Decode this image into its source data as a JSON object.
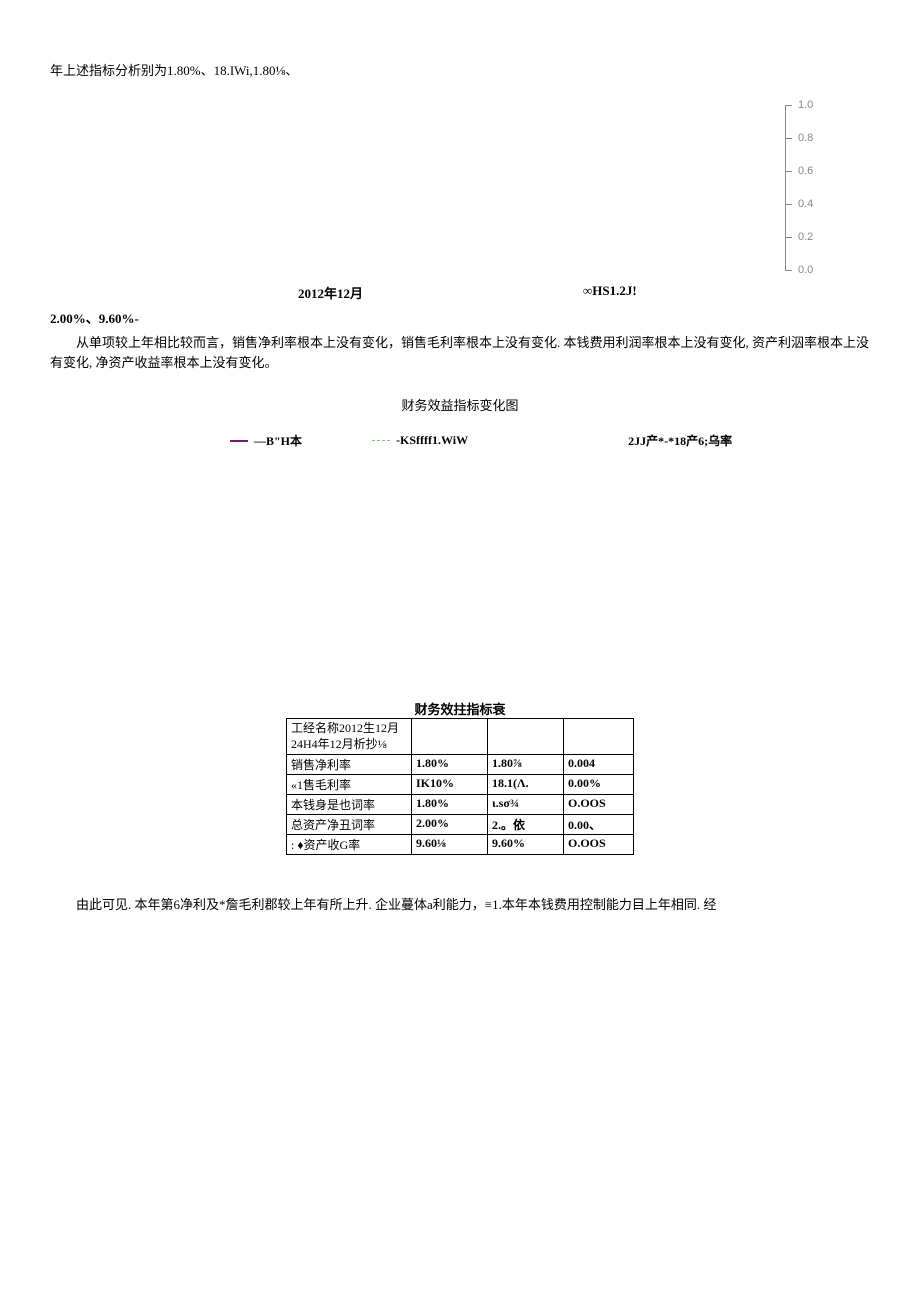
{
  "line1": "年上述指标分析别为1.80%、18.IWi,1.80⅛、",
  "axis_ticks": [
    "1.0",
    "0.8",
    "0.6",
    "0.4",
    "0.2",
    "0.0"
  ],
  "mid_text1": "2012年12月",
  "mid_text2": "∞HS1.2J!",
  "line2": "2.00%、9.60%-",
  "para1": "从单项较上年相比较而言，销售净利率根本上没有变化，销售毛利率根本上没有变化. 本钱费用利润率根本上没有变化, 资产利泅率根本上没有变化, 净资产收益率根本上没有变化。",
  "chart_title": "财务效益指标变化图",
  "legend": {
    "l1": "—B\"H本",
    "l2": "-KSffff1.WiW",
    "l3": "2JJ产*-*18产6;乌率"
  },
  "table_title": "财务效拄指标衰",
  "table": {
    "header": "工经名称2012生12月24H4年12月析抄⅛",
    "rows": [
      {
        "name": "销售净利率",
        "c2": "1.80%",
        "c3": "1.80⅞",
        "c4": "0.004"
      },
      {
        "name": "«1售毛利率",
        "c2": "IK10%",
        "c3": "18.1(Λ.",
        "c4": "0.00%"
      },
      {
        "name": "本钱身是也词率",
        "c2": "1.80%",
        "c3": "ι.sσ¾",
        "c4": "O.OOS"
      },
      {
        "name": "总资产净丑词率",
        "c2": "2.00%",
        "c3": "2.。依",
        "c4": "0.00、"
      },
      {
        "name": ":  ♦资产收G率",
        "c2": "9.60⅛",
        "c3": "9.60%",
        "c4": "O.OOS"
      }
    ]
  },
  "final_para": "由此可见. 本年第6净利及*詹毛利郡较上年有所上升. 企业蔓体a利能力，≡1.本年本钱费用控制能力目上年相同. 经",
  "chart_data": {
    "type": "line",
    "title": "财务效益指标变化图",
    "x_categories": [
      "2012年12月",
      "2014年12月"
    ],
    "ylim_right_axis": [
      0.0,
      1.0
    ],
    "y_ticks": [
      0.0,
      0.2,
      0.4,
      0.6,
      0.8,
      1.0
    ],
    "series": [
      {
        "name": "销售净利率",
        "values": [
          1.8,
          1.8
        ],
        "unit": "%"
      },
      {
        "name": "销售毛利率",
        "values": [
          18.1,
          18.1
        ],
        "unit": "%"
      },
      {
        "name": "本钱费用利润率",
        "values": [
          1.8,
          1.8
        ],
        "unit": "%"
      },
      {
        "name": "总资产净利润率",
        "values": [
          2.0,
          2.0
        ],
        "unit": "%"
      },
      {
        "name": "净资产收益率",
        "values": [
          9.6,
          9.6
        ],
        "unit": "%"
      }
    ],
    "legend_labels_as_rendered": [
      "—B\"H本",
      "-KSffff1.WiW",
      "2JJ产*-*18产6;乌率"
    ]
  }
}
